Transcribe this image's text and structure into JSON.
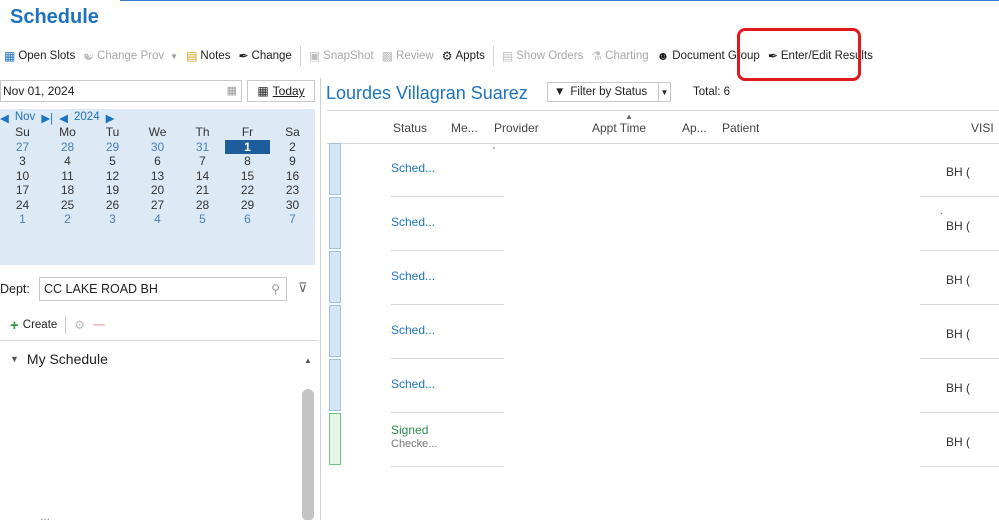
{
  "title": "Schedule",
  "toolbar": {
    "items": [
      {
        "label": "Open Slots",
        "icon": "grid-icon",
        "enabled": true
      },
      {
        "label": "Change Prov",
        "icon": "user-switch-icon",
        "enabled": false
      },
      {
        "label": "Notes",
        "icon": "notes-icon",
        "enabled": true
      },
      {
        "label": "Change",
        "icon": "pen-icon",
        "enabled": true
      },
      {
        "label": "SnapShot",
        "icon": "snapshot-icon",
        "enabled": false
      },
      {
        "label": "Review",
        "icon": "folder-icon",
        "enabled": false
      },
      {
        "label": "Appts",
        "icon": "appts-icon",
        "enabled": true
      },
      {
        "label": "Show Orders",
        "icon": "clipboard-icon",
        "enabled": false
      },
      {
        "label": "Charting",
        "icon": "charting-icon",
        "enabled": false
      },
      {
        "label": "Document Group",
        "icon": "group-icon",
        "enabled": true
      },
      {
        "label": "Enter/Edit Results",
        "icon": "edit-results-icon",
        "enabled": true
      }
    ]
  },
  "date_picker": {
    "value": "Nov 01, 2024",
    "today_label": "Today"
  },
  "calendar": {
    "month": "Nov",
    "year": "2024",
    "weekdays": [
      "Su",
      "Mo",
      "Tu",
      "We",
      "Th",
      "Fr",
      "Sa"
    ],
    "weeks": [
      [
        "27",
        "28",
        "29",
        "30",
        "31",
        "1",
        "2"
      ],
      [
        "3",
        "4",
        "5",
        "6",
        "7",
        "8",
        "9"
      ],
      [
        "10",
        "11",
        "12",
        "13",
        "14",
        "15",
        "16"
      ],
      [
        "17",
        "18",
        "19",
        "20",
        "21",
        "22",
        "23"
      ],
      [
        "24",
        "25",
        "26",
        "27",
        "28",
        "29",
        "30"
      ],
      [
        "1",
        "2",
        "3",
        "4",
        "5",
        "6",
        "7"
      ]
    ],
    "selected": "1"
  },
  "dept": {
    "label": "Dept:",
    "value": "CC LAKE ROAD BH"
  },
  "create_label": "Create",
  "my_schedule_label": "My Schedule",
  "ellipsis": "...",
  "main": {
    "provider_name": "Lourdes Villagran Suarez",
    "filter_label": "Filter by Status",
    "total_label": "Total: 6",
    "columns": [
      "Status",
      "Me...",
      "Provider",
      "Appt Time",
      "Ap...",
      "Patient",
      "VISI"
    ],
    "rows": [
      {
        "status": "Sched...",
        "sub": "",
        "visit": "BH (",
        "kind": "sched"
      },
      {
        "status": "Sched...",
        "sub": "",
        "visit": "BH (",
        "kind": "sched"
      },
      {
        "status": "Sched...",
        "sub": "",
        "visit": "BH (",
        "kind": "sched"
      },
      {
        "status": "Sched...",
        "sub": "",
        "visit": "BH (",
        "kind": "sched"
      },
      {
        "status": "Sched...",
        "sub": "",
        "visit": "BH (",
        "kind": "sched"
      },
      {
        "status": "Signed",
        "sub": "Checke...",
        "visit": "BH (",
        "kind": "signed"
      }
    ]
  },
  "colors": {
    "accent": "#1e73be",
    "highlight_box": "#e0191e",
    "calendar_bg": "#dde9f5",
    "selected_day": "#1e5d9b",
    "signed": "#2f8a4d"
  }
}
